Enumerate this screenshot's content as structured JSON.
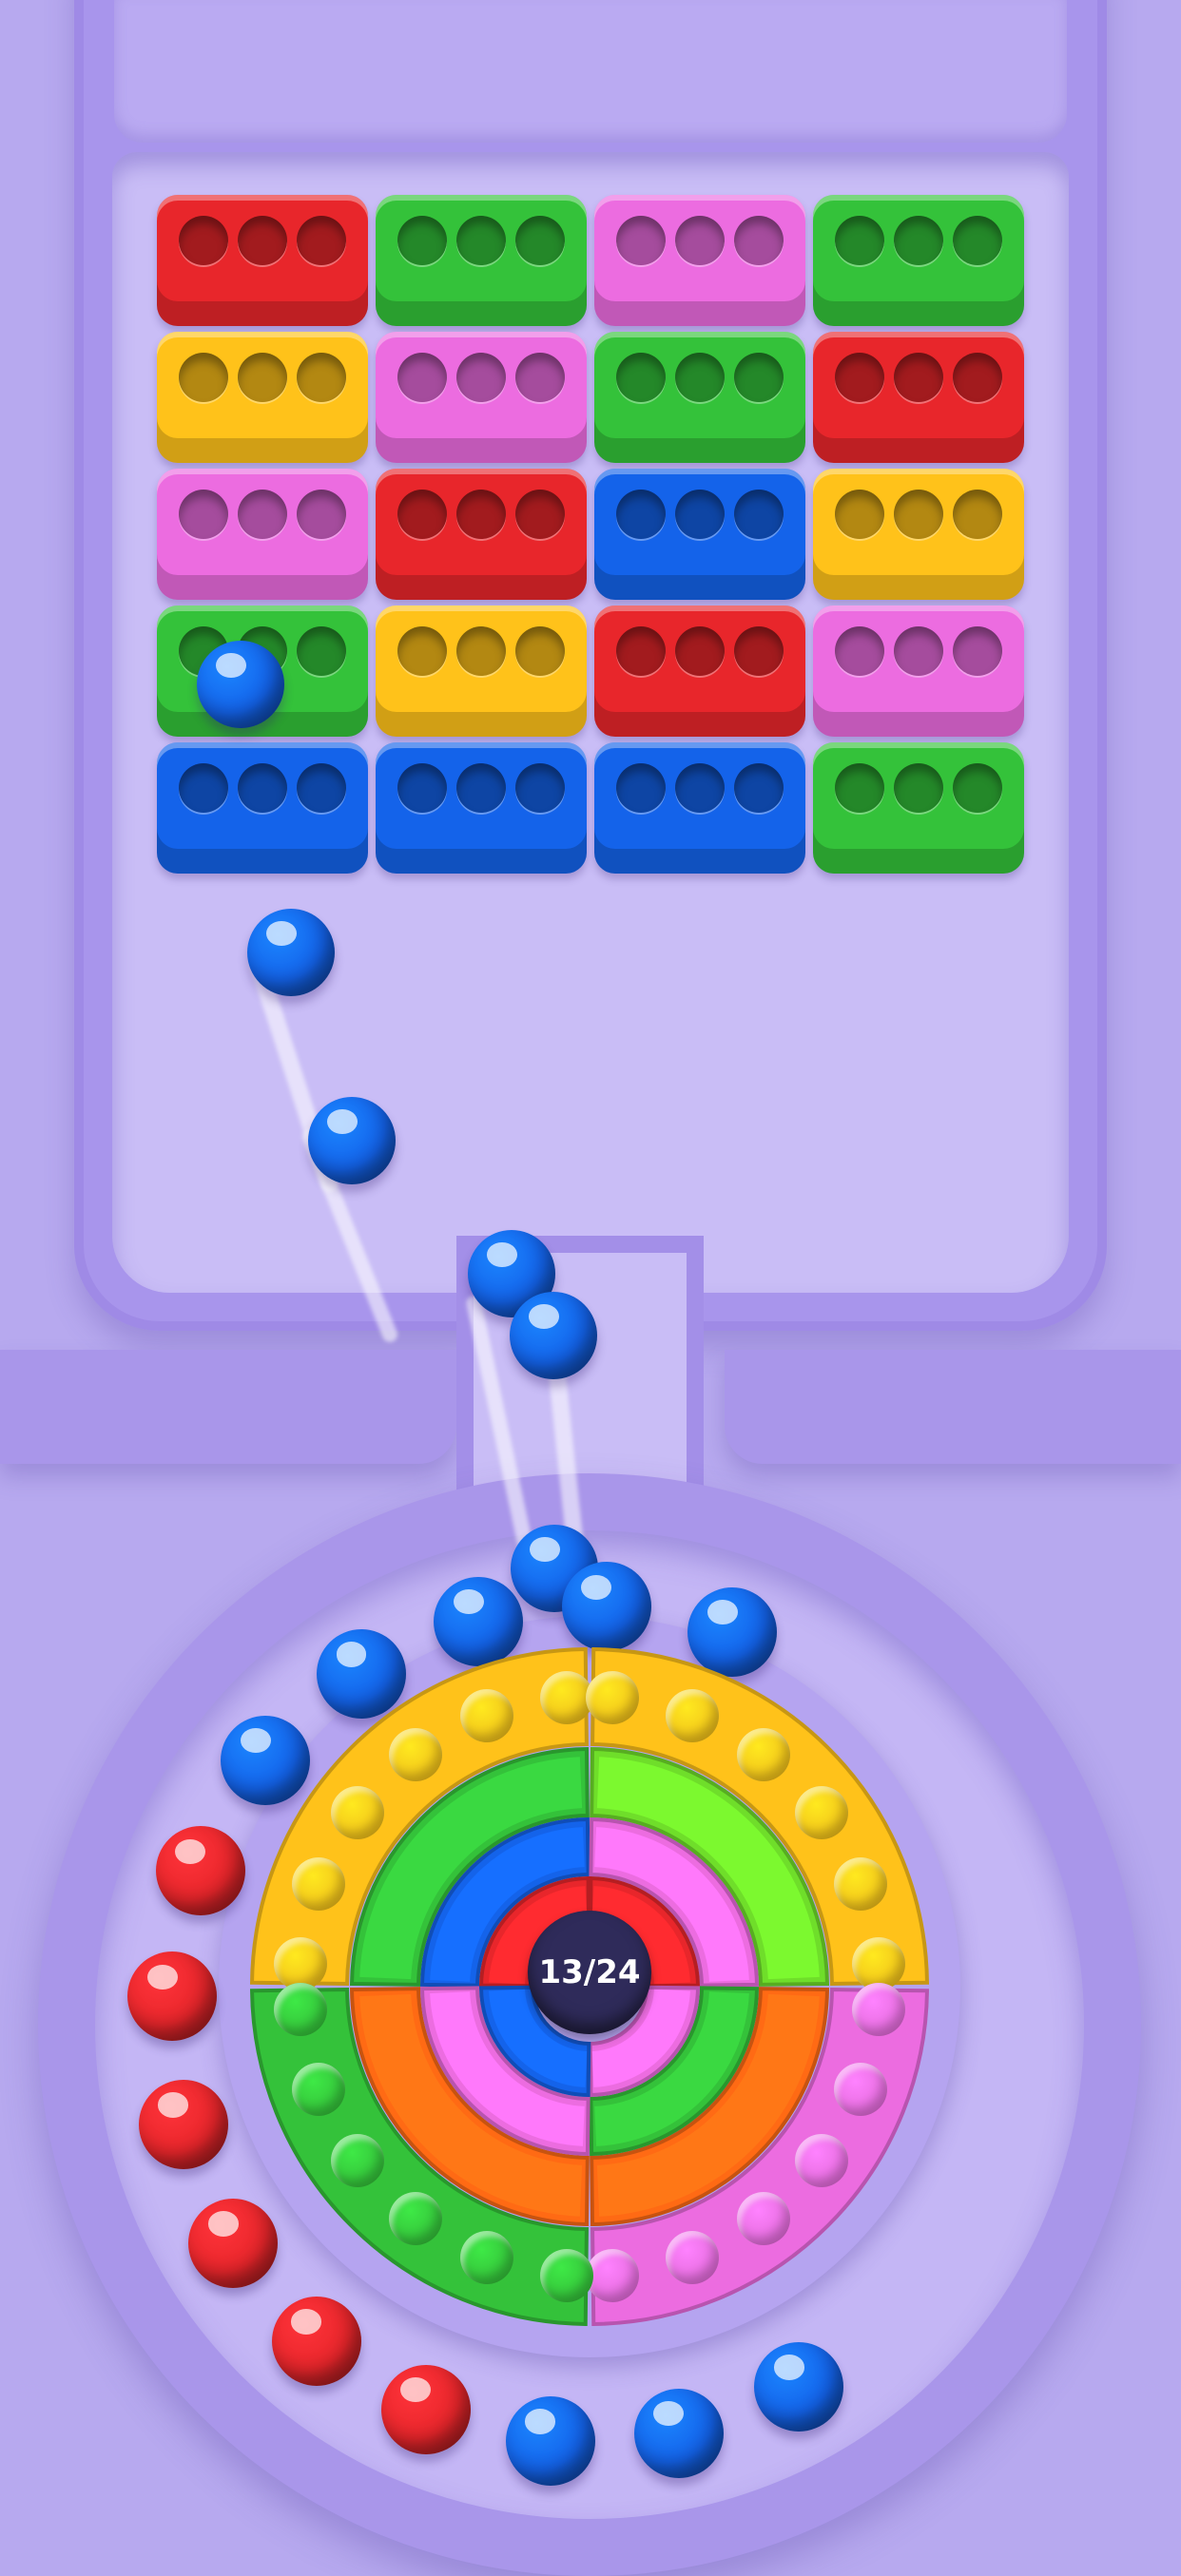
{
  "game": {
    "counter_text": "13/24",
    "colors": {
      "red": "#e8262b",
      "green": "#34c23a",
      "pink": "#ec6ce0",
      "yellow": "#ffc21a",
      "blue": "#1463ea",
      "orange": "#ff6a14",
      "lime": "#6fde2a"
    },
    "brick_grid": [
      [
        "red",
        "green",
        "pink",
        "green"
      ],
      [
        "yellow",
        "pink",
        "green",
        "red"
      ],
      [
        "pink",
        "red",
        "blue",
        "yellow"
      ],
      [
        "green",
        "yellow",
        "red",
        "pink"
      ],
      [
        "blue",
        "blue",
        "blue",
        "green"
      ]
    ],
    "holes_per_brick": 3,
    "queue_balls": [
      "blue",
      "blue",
      "blue",
      "blue",
      "blue",
      "red",
      "red",
      "red",
      "red",
      "red",
      "red",
      "blue",
      "blue",
      "blue"
    ],
    "flying_balls": [
      "blue",
      "blue",
      "blue",
      "blue",
      "blue",
      "blue"
    ],
    "wheel": {
      "outer_ring": {
        "top_left": "yellow",
        "top_right": "yellow",
        "bottom_left": "green",
        "bottom_right": "pink"
      },
      "ring_2": {
        "top_left": "green",
        "top_right": "lime",
        "bottom_left": "orange",
        "bottom_right": "orange"
      },
      "ring_3": {
        "top_left": "blue",
        "top_right": "pink",
        "bottom_left": "pink",
        "bottom_right": "green"
      },
      "ring_4": {
        "top_left": "red",
        "top_right": "red",
        "bottom_left": "blue",
        "bottom_right": "pink"
      }
    }
  }
}
